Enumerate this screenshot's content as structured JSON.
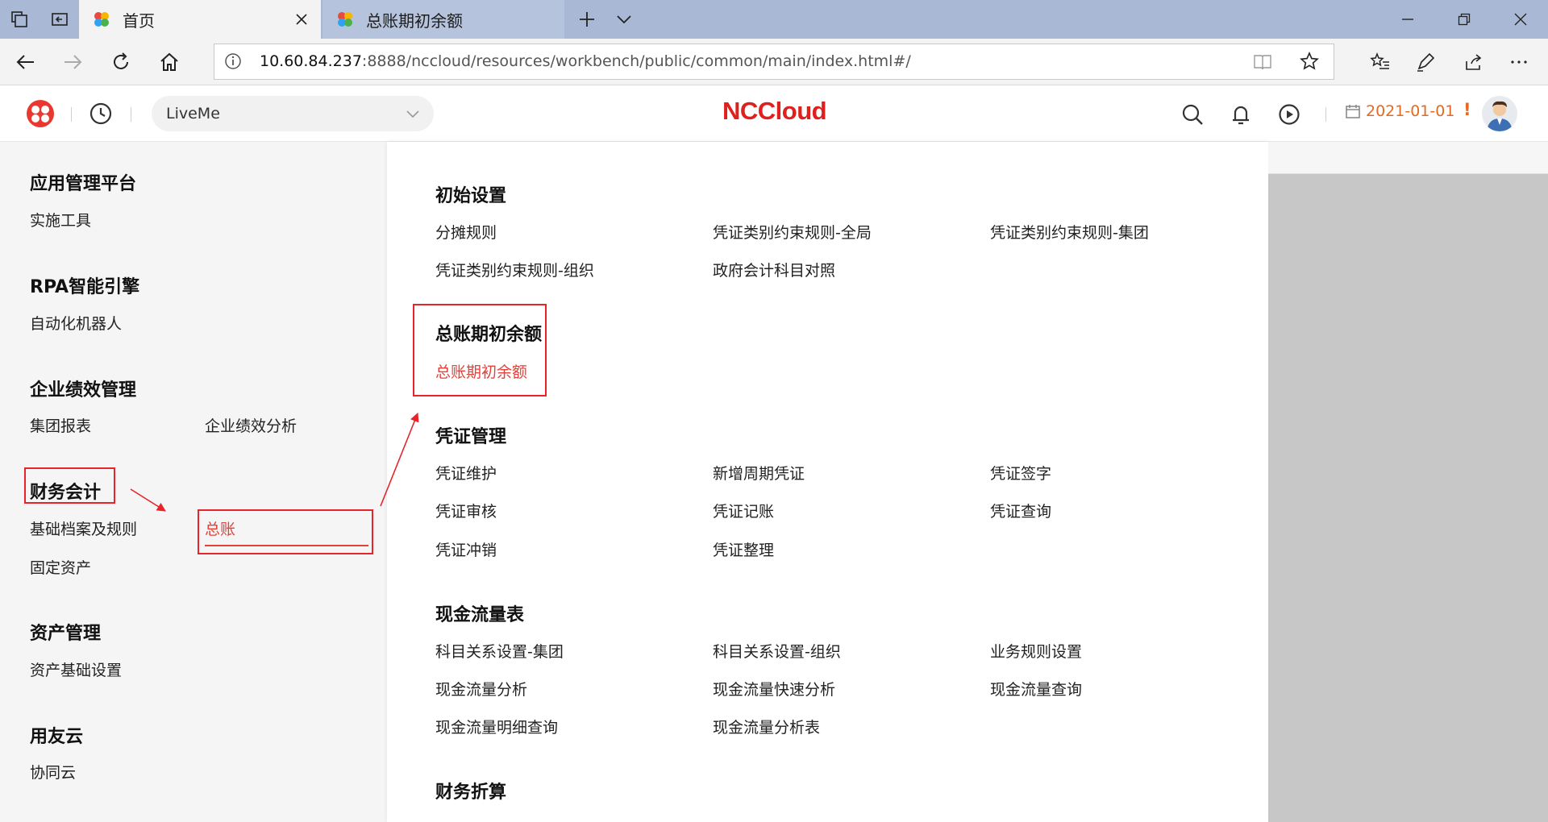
{
  "browser": {
    "tabs": [
      {
        "title": "首页",
        "active": true
      },
      {
        "title": "总账期初余额",
        "active": false
      }
    ],
    "address": {
      "host": "10.60.84.237",
      "rest": ":8888/nccloud/resources/workbench/public/common/main/index.html#/"
    }
  },
  "app": {
    "org": "LiveMe",
    "brand": "NCCloud",
    "date": "2021-01-01",
    "warning": "!"
  },
  "sidebar": {
    "sections": [
      {
        "title": "应用管理平台",
        "items": [
          "实施工具"
        ]
      },
      {
        "title": "RPA智能引擎",
        "items": [
          "自动化机器人"
        ]
      },
      {
        "title": "企业绩效管理",
        "items": [
          "集团报表",
          "企业绩效分析"
        ]
      },
      {
        "title": "财务会计",
        "items": [
          "基础档案及规则",
          "总账",
          "固定资产"
        ]
      },
      {
        "title": "资产管理",
        "items": [
          "资产基础设置"
        ]
      },
      {
        "title": "用友云",
        "items": [
          "协同云"
        ]
      }
    ]
  },
  "content": {
    "groups": [
      {
        "title": "初始设置",
        "items": [
          "分摊规则",
          "凭证类别约束规则-全局",
          "凭证类别约束规则-集团",
          "凭证类别约束规则-组织",
          "政府会计科目对照"
        ]
      },
      {
        "title": "总账期初余额",
        "items": [
          "总账期初余额"
        ]
      },
      {
        "title": "凭证管理",
        "items": [
          "凭证维护",
          "新增周期凭证",
          "凭证签字",
          "凭证审核",
          "凭证记账",
          "凭证查询",
          "凭证冲销",
          "凭证整理"
        ]
      },
      {
        "title": "现金流量表",
        "items": [
          "科目关系设置-集团",
          "科目关系设置-组织",
          "业务规则设置",
          "现金流量分析",
          "现金流量快速分析",
          "现金流量查询",
          "现金流量明细查询",
          "现金流量分析表"
        ]
      },
      {
        "title": "财务折算",
        "items": []
      }
    ]
  },
  "colors": {
    "accent": "#e2423a",
    "brand": "#e0201c",
    "date": "#e36a1f"
  }
}
